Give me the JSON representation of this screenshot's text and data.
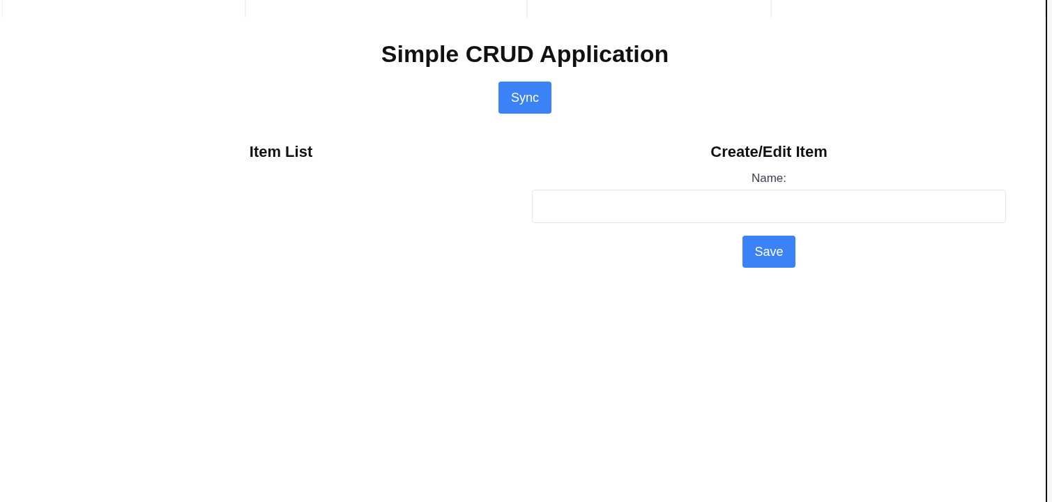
{
  "header": {
    "title": "Simple CRUD Application",
    "sync_button": "Sync"
  },
  "item_list": {
    "heading": "Item List"
  },
  "editor": {
    "heading": "Create/Edit Item",
    "name_label": "Name:",
    "save_button": "Save"
  }
}
